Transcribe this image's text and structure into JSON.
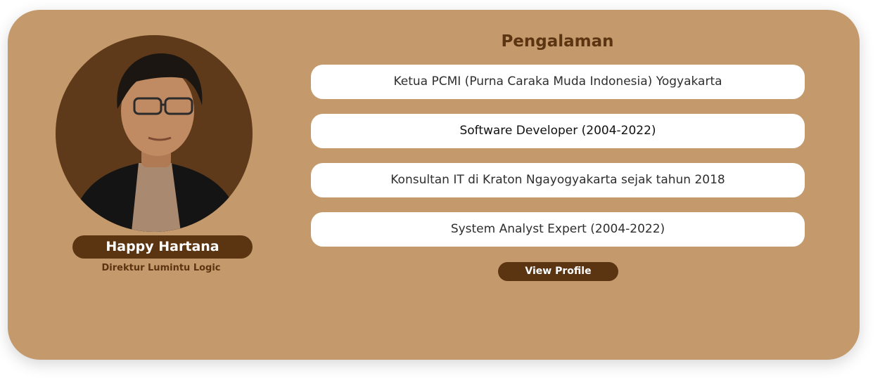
{
  "profile": {
    "name": "Happy Hartana",
    "title": "Direktur Lumintu Logic",
    "photo_icon": "profile-photo"
  },
  "experience": {
    "heading": "Pengalaman",
    "items": [
      {
        "label": "Ketua PCMI (Purna Caraka Muda Indonesia) Yogyakarta"
      },
      {
        "label": "Software Developer (2004-2022)"
      },
      {
        "label": "Konsultan IT di Kraton Ngayogyakarta sejak tahun 2018"
      },
      {
        "label": "System Analyst Expert (2004-2022)"
      }
    ]
  },
  "actions": {
    "view_profile_label": "View Profile"
  },
  "colors": {
    "card_background": "#c4996b",
    "accent_brown": "#5b3411",
    "avatar_background": "#5e3a1a",
    "item_background": "#ffffff"
  }
}
